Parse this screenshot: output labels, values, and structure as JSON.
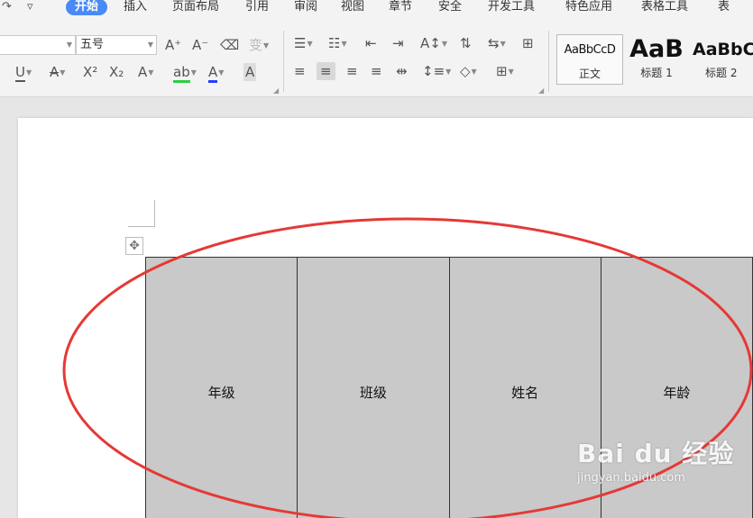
{
  "quick_access": {
    "redo_icon": "↷",
    "more_icon": "▿"
  },
  "menu": {
    "items": [
      "开始",
      "插入",
      "页面布局",
      "引用",
      "审阅",
      "视图",
      "章节",
      "安全",
      "开发工具",
      "特色应用",
      "表格工具",
      "表"
    ],
    "active_index": 0,
    "accent_color": "#4a8af4"
  },
  "ribbon": {
    "font_size_value": "五号",
    "font_buttons": [
      "A⁺",
      "A⁻",
      "⌫",
      "变"
    ],
    "format_buttons": [
      "U",
      "A",
      "X²",
      "X₂",
      "A",
      "ab",
      "A",
      "A"
    ],
    "para_row1": [
      "☰",
      "☷",
      "⇤",
      "⇥",
      "A↕",
      "⇅",
      "⇆",
      "⊞"
    ],
    "para_row2": [
      "≡",
      "≡",
      "≡",
      "≡",
      "⇹",
      "↕≡",
      "◇",
      "⊞"
    ]
  },
  "styles": [
    {
      "sample": "AaBbCcD",
      "label": "正文"
    },
    {
      "sample": "AaB",
      "label": "标题 1"
    },
    {
      "sample": "AaBbC",
      "label": "标题 2"
    }
  ],
  "table": {
    "headers": [
      "年级",
      "班级",
      "姓名",
      "年龄"
    ],
    "fill_color": "#c9c9c9"
  },
  "annotation": {
    "color": "#e53935"
  },
  "watermark": {
    "logo": "Bai du 经验",
    "site": "jingyan.baidu.com"
  }
}
